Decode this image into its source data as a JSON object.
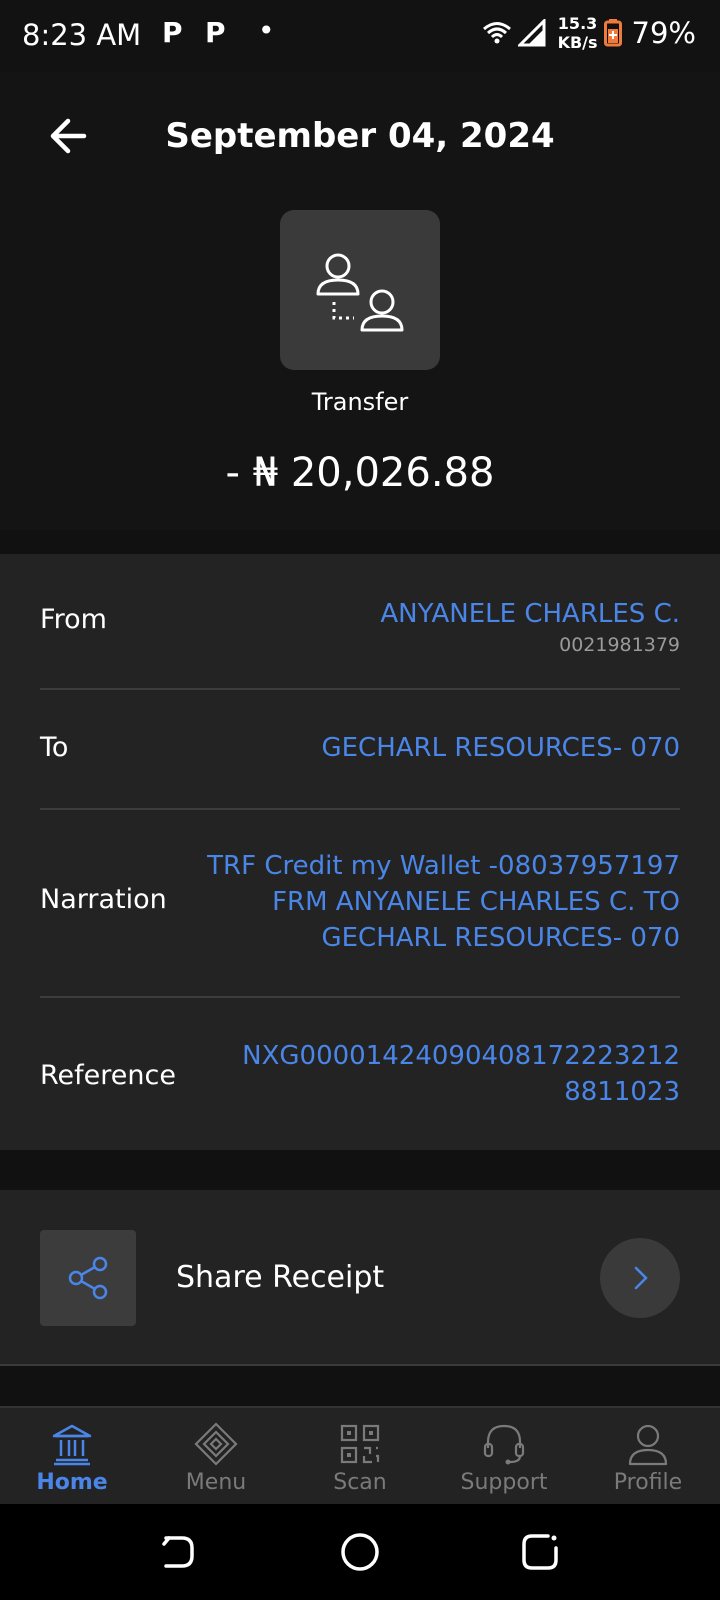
{
  "status_bar": {
    "time": "8:23 AM",
    "notif_icon_1": "P",
    "notif_icon_2": "P",
    "notif_dot": "•",
    "net_speed_value": "15.3",
    "net_speed_unit": "KB/s",
    "battery": "79%"
  },
  "header": {
    "title": "September 04, 2024",
    "transaction_type": "Transfer",
    "amount": "- ₦ 20,026.88",
    "icon": "transfer-users-icon"
  },
  "details": {
    "from": {
      "label": "From",
      "name": "ANYANELE CHARLES C.",
      "account": "0021981379"
    },
    "to": {
      "label": "To",
      "value": "GECHARL RESOURCES- 070"
    },
    "narration": {
      "label": "Narration",
      "lines": [
        "TRF Credit my Wallet -08037957197",
        "FRM ANYANELE CHARLES C. TO",
        "GECHARL RESOURCES- 070"
      ]
    },
    "reference": {
      "label": "Reference",
      "lines": [
        "NXG00001424090408172223212",
        "8811023"
      ]
    }
  },
  "share": {
    "label": "Share Receipt",
    "icon": "share-icon",
    "arrow_icon": "chevron-right-icon"
  },
  "bottom_nav": [
    {
      "label": "Home",
      "icon": "bank-icon",
      "active": true
    },
    {
      "label": "Menu",
      "icon": "menu-diamond-icon",
      "active": false
    },
    {
      "label": "Scan",
      "icon": "qr-scan-icon",
      "active": false
    },
    {
      "label": "Support",
      "icon": "headset-icon",
      "active": false
    },
    {
      "label": "Profile",
      "icon": "user-icon",
      "active": false
    }
  ],
  "colors": {
    "accent": "#4a86e8",
    "background": "#141414",
    "card": "#232323",
    "muted": "#7a7a7a"
  }
}
